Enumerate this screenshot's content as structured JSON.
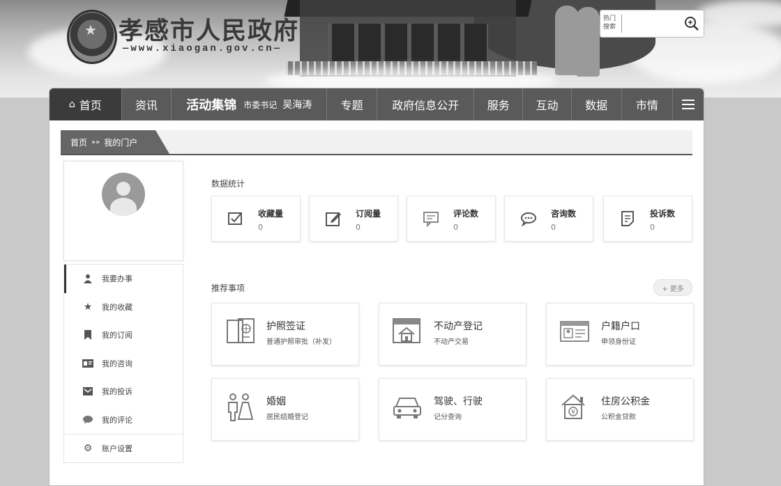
{
  "header": {
    "site_title": "孝感市人民政府",
    "site_url": "—www.xiaogan.gov.cn—",
    "search": {
      "label": "热门搜索",
      "placeholder": ""
    }
  },
  "nav": {
    "home": "首页",
    "news": "资讯",
    "featured": "活动集锦",
    "featured_sub": "市委书记",
    "featured_name": "吴海涛",
    "topics": "专题",
    "gov_info": "政府信息公开",
    "services": "服务",
    "interaction": "互动",
    "data": "数据",
    "city_info": "市情"
  },
  "breadcrumb": {
    "home": "首页",
    "separator": "»»",
    "current": "我的门户"
  },
  "sidebar": {
    "items": [
      {
        "label": "我要办事",
        "icon": "user-icon"
      },
      {
        "label": "我的收藏",
        "icon": "star-icon"
      },
      {
        "label": "我的订阅",
        "icon": "bookmark-icon"
      },
      {
        "label": "我的咨询",
        "icon": "id-card-icon"
      },
      {
        "label": "我的投诉",
        "icon": "inbox-icon"
      },
      {
        "label": "我的评论",
        "icon": "comment-icon"
      },
      {
        "label": "账户设置",
        "icon": "gear-icon"
      }
    ]
  },
  "stats": {
    "title": "数据统计",
    "items": [
      {
        "label": "收藏量",
        "value": "0",
        "icon": "checkbox-icon"
      },
      {
        "label": "订阅量",
        "value": "0",
        "icon": "edit-icon"
      },
      {
        "label": "评论数",
        "value": "0",
        "icon": "chat-icon"
      },
      {
        "label": "咨询数",
        "value": "0",
        "icon": "speech-bubble-icon"
      },
      {
        "label": "投诉数",
        "value": "0",
        "icon": "document-icon"
      }
    ]
  },
  "recommended": {
    "title": "推荐事项",
    "more": "+ 更多",
    "items": [
      {
        "title": "护照签证",
        "subtitle": "普通护照审批（补发）",
        "icon": "passport-icon"
      },
      {
        "title": "不动产登记",
        "subtitle": "不动产交易",
        "icon": "house-certificate-icon"
      },
      {
        "title": "户籍户口",
        "subtitle": "申领身份证",
        "icon": "id-card-icon"
      },
      {
        "title": "婚姻",
        "subtitle": "居民结婚登记",
        "icon": "couple-icon"
      },
      {
        "title": "驾驶、行驶",
        "subtitle": "记分查询",
        "icon": "car-icon"
      },
      {
        "title": "住房公积金",
        "subtitle": "公积金贷款",
        "icon": "housing-fund-icon"
      }
    ]
  }
}
